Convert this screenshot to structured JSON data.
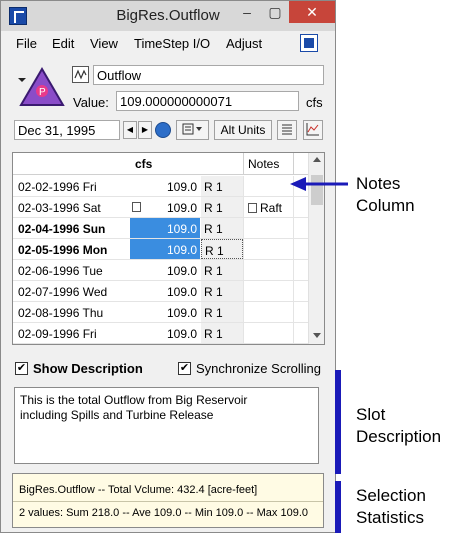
{
  "window": {
    "title": "BigRes.Outflow"
  },
  "menu": {
    "file": "File",
    "edit": "Edit",
    "view": "View",
    "timestep_io": "TimeStep I/O",
    "adjust": "Adjust"
  },
  "slot": {
    "object_icon_letter": "P",
    "name": "Outflow",
    "value_label": "Value:",
    "value": "109.000000000071",
    "units": "cfs"
  },
  "toolbar": {
    "date": "Dec 31, 1995",
    "prev": "◀",
    "next": "▶",
    "alt_units": "Alt Units"
  },
  "table": {
    "header_units": "cfs",
    "header_notes": "Notes",
    "rows": [
      {
        "date": "02-02-1996 Fri",
        "value": "109.0",
        "flag": "R  1",
        "note": ""
      },
      {
        "date": "02-03-1996 Sat",
        "value": "109.0",
        "flag": "R  1",
        "note": "Raft"
      },
      {
        "date": "02-04-1996 Sun",
        "value": "109.0",
        "flag": "R  1",
        "note": ""
      },
      {
        "date": "02-05-1996 Mon",
        "value": "109.0",
        "flag": "R  1",
        "note": ""
      },
      {
        "date": "02-06-1996 Tue",
        "value": "109.0",
        "flag": "R  1",
        "note": ""
      },
      {
        "date": "02-07-1996 Wed",
        "value": "109.0",
        "flag": "R  1",
        "note": ""
      },
      {
        "date": "02-08-1996 Thu",
        "value": "109.0",
        "flag": "R  1",
        "note": ""
      },
      {
        "date": "02-09-1996 Fri",
        "value": "109.0",
        "flag": "R  1",
        "note": ""
      }
    ]
  },
  "options": {
    "show_description": "Show Description",
    "synchronize_scrolling": "Synchronize Scrolling"
  },
  "description": {
    "text": "This is the total Outflow from Big Reservoir\nincluding Spills and Turbine Release"
  },
  "statistics": {
    "total_line": "BigRes.Outflow -- Total Vclume: 432.4 [acre-feet]",
    "selection_line": "2 values:  Sum 218.0 -- Ave 109.0 -- Min 109.0 -- Max 109.0"
  },
  "annotations": {
    "notes_column": "Notes\nColumn",
    "slot_description": "Slot\nDescription",
    "selection_statistics": "Selection\nStatistics"
  },
  "colors": {
    "selection": "#3a8de0",
    "annotation": "#1a1ab8",
    "close_button": "#c7453a"
  }
}
